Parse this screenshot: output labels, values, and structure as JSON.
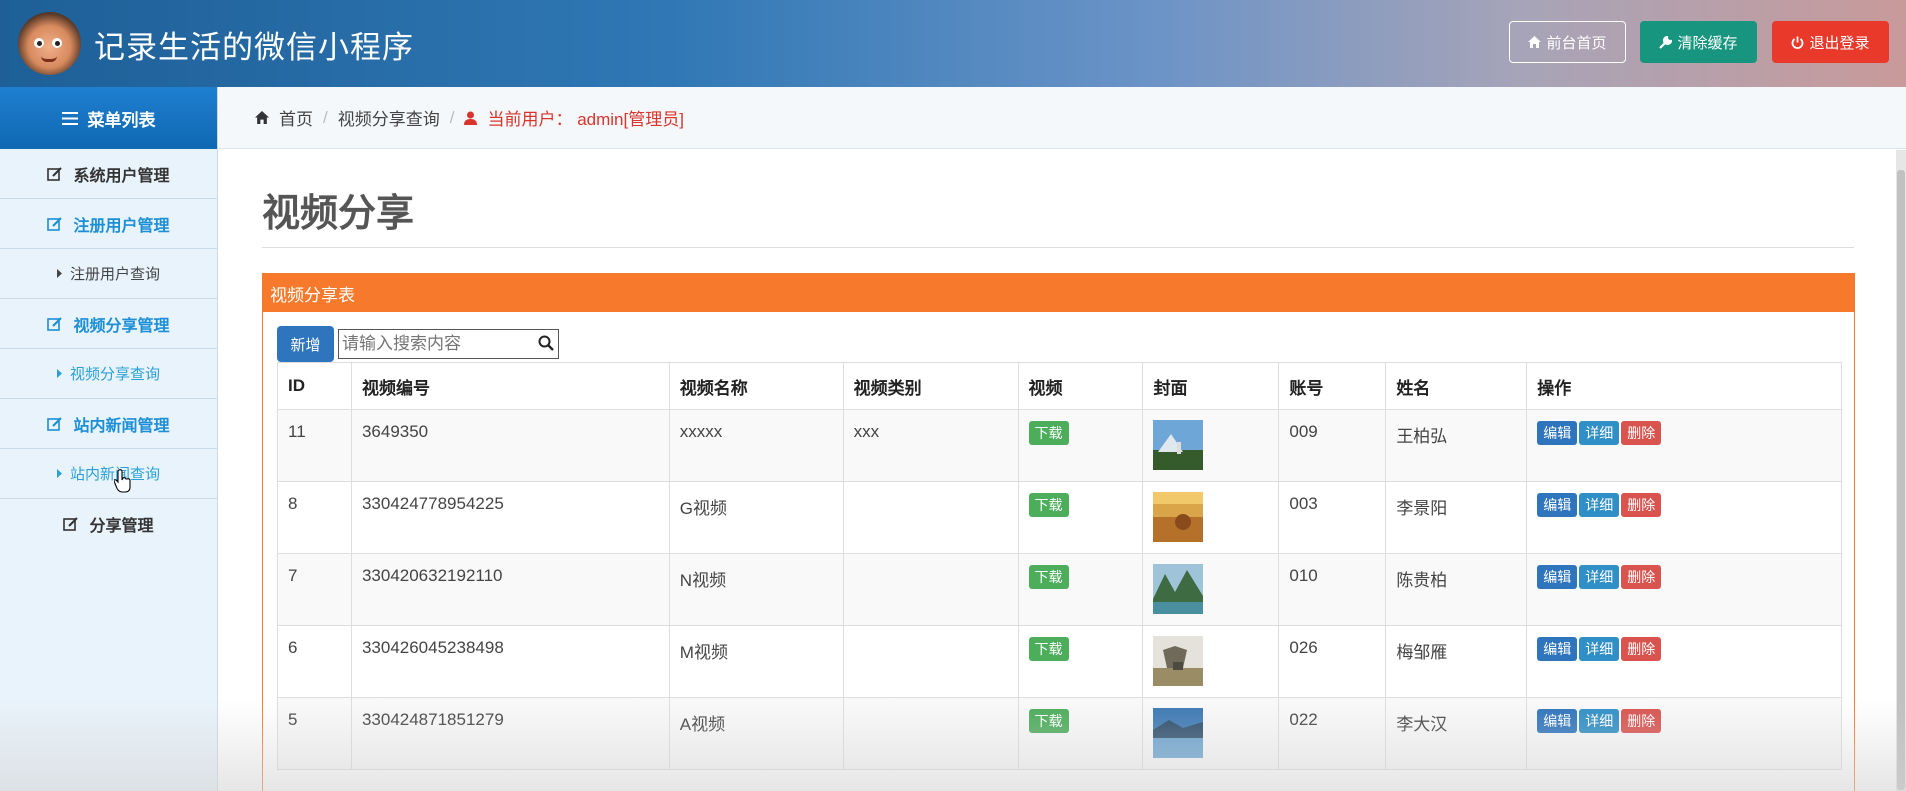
{
  "header": {
    "title": "记录生活的微信小程序",
    "buttons": {
      "front": "前台首页",
      "clear_cache": "清除缓存",
      "logout": "退出登录"
    }
  },
  "sidebar": {
    "head": "菜单列表",
    "items": [
      {
        "label": "系统用户管理"
      },
      {
        "label": "注册用户管理"
      },
      {
        "label": "注册用户查询"
      },
      {
        "label": "视频分享管理"
      },
      {
        "label": "视频分享查询"
      },
      {
        "label": "站内新闻管理"
      },
      {
        "label": "站内新闻查询"
      },
      {
        "label": "分享管理"
      }
    ]
  },
  "breadcrumb": {
    "home": "首页",
    "current": "视频分享查询",
    "user": "当前用户： admin[管理员]"
  },
  "page_title": "视频分享",
  "panel": {
    "title": "视频分享表",
    "add_label": "新增",
    "search_placeholder": "请输入搜索内容",
    "columns": [
      "ID",
      "视频编号",
      "视频名称",
      "视频类别",
      "视频",
      "封面",
      "账号",
      "姓名",
      "操作"
    ],
    "download_label": "下载",
    "actions": {
      "edit": "编辑",
      "detail": "详细",
      "delete": "删除"
    },
    "rows": [
      {
        "id": "11",
        "code": "3649350",
        "name": "xxxxx",
        "category": "xxx",
        "account": "009",
        "person": "王柏弘"
      },
      {
        "id": "8",
        "code": "330424778954225",
        "name": "G视频",
        "category": "",
        "account": "003",
        "person": "李景阳"
      },
      {
        "id": "7",
        "code": "330420632192110",
        "name": "N视频",
        "category": "",
        "account": "010",
        "person": "陈贵柏"
      },
      {
        "id": "6",
        "code": "330426045238498",
        "name": "M视频",
        "category": "",
        "account": "026",
        "person": "梅邹雁"
      },
      {
        "id": "5",
        "code": "330424871851279",
        "name": "A视频",
        "category": "",
        "account": "022",
        "person": "李大汉"
      }
    ]
  }
}
